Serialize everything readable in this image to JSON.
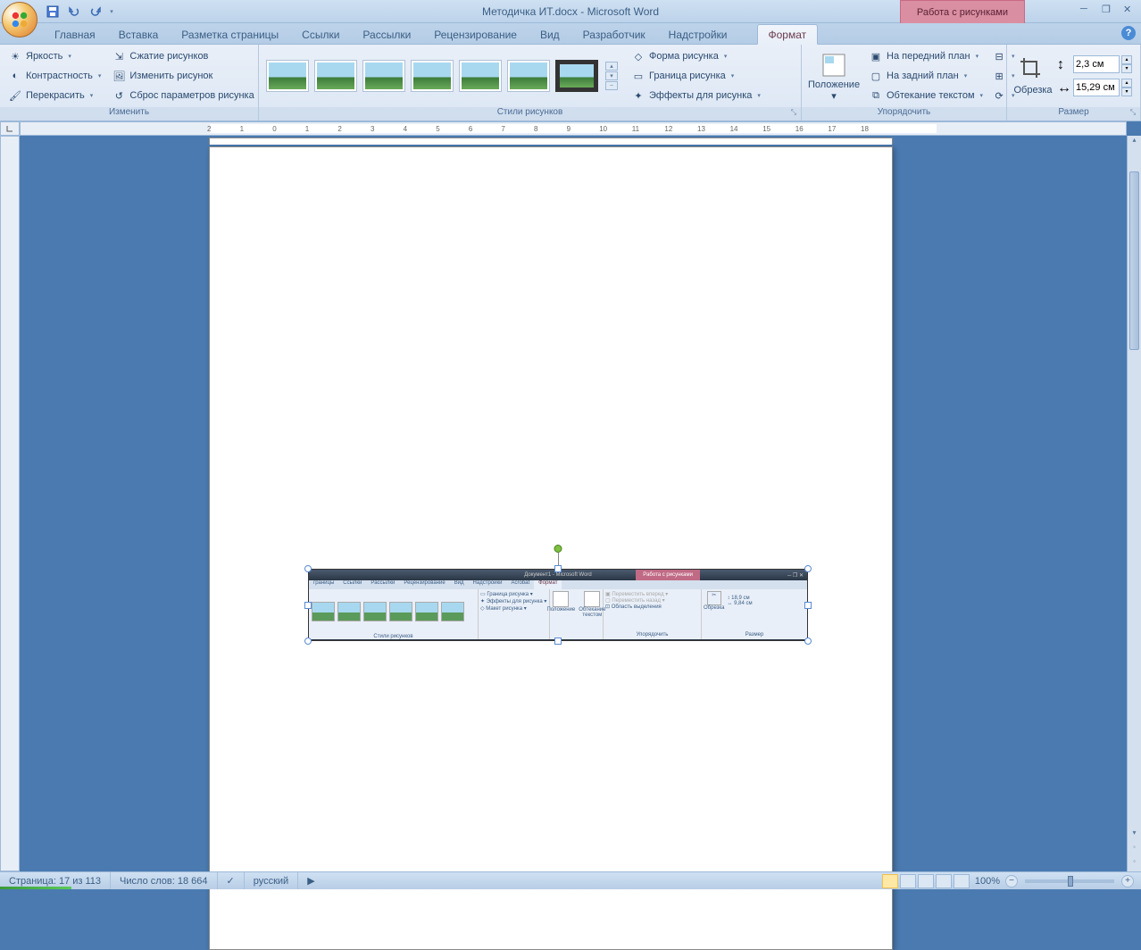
{
  "app": {
    "title": "Методичка ИТ.docx - Microsoft Word",
    "context_tab_title": "Работа с рисунками"
  },
  "tabs": {
    "items": [
      "Главная",
      "Вставка",
      "Разметка страницы",
      "Ссылки",
      "Рассылки",
      "Рецензирование",
      "Вид",
      "Разработчик",
      "Надстройки"
    ],
    "context": "Формат"
  },
  "ribbon": {
    "adjust": {
      "label": "Изменить",
      "brightness": "Яркость",
      "contrast": "Контрастность",
      "recolor": "Перекрасить",
      "compress": "Сжатие рисунков",
      "change": "Изменить рисунок",
      "reset": "Сброс параметров рисунка"
    },
    "styles": {
      "label": "Стили рисунков",
      "shape": "Форма рисунка",
      "border": "Граница рисунка",
      "effects": "Эффекты для рисунка"
    },
    "arrange": {
      "label": "Упорядочить",
      "position": "Положение",
      "front": "На передний план",
      "back": "На задний план",
      "wrap": "Обтекание текстом"
    },
    "size": {
      "label": "Размер",
      "crop": "Обрезка",
      "height": "2,3 см",
      "width": "15,29 см"
    }
  },
  "ruler": {
    "ticks": [
      -2,
      -1,
      0,
      1,
      2,
      3,
      4,
      5,
      6,
      7,
      8,
      9,
      10,
      11,
      12,
      13,
      14,
      15,
      16,
      17,
      18
    ]
  },
  "statusbar": {
    "page": "Страница: 17 из 113",
    "words": "Число слов: 18 664",
    "lang": "русский",
    "zoom": "100%"
  },
  "inner_image": {
    "title": "Документ1 - Microsoft Word",
    "context": "Работа с рисунками",
    "tabs": [
      "границы",
      "Ссылки",
      "Рассылки",
      "Рецензирование",
      "Вид",
      "Надстройки",
      "Acrobat",
      "Формат"
    ],
    "groups": {
      "styles": "Стили рисунков",
      "border": "Граница рисунка",
      "effects": "Эффекты для рисунка",
      "layout": "Макет рисунка",
      "position": "Положение",
      "wrap": "Обтекание текстом",
      "fwd": "Переместить вперед",
      "back": "Переместить назад",
      "pane": "Область выделения",
      "arrange": "Упорядочить",
      "crop": "Обрезка",
      "h": "18,9 см",
      "w": "9,84 см",
      "size": "Размер"
    }
  }
}
